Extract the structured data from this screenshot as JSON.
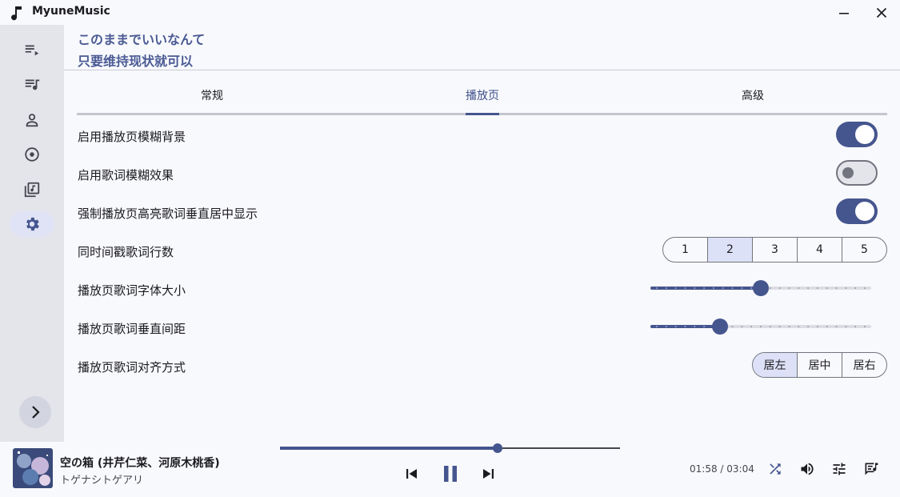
{
  "window": {
    "title": "MyuneMusic",
    "minimize_icon": "minimize-icon",
    "close_icon": "close-icon"
  },
  "sidebar": {
    "items": [
      {
        "icon": "playlist-play-icon",
        "active": false
      },
      {
        "icon": "queue-music-icon",
        "active": false
      },
      {
        "icon": "person-icon",
        "active": false
      },
      {
        "icon": "album-icon",
        "active": false
      },
      {
        "icon": "library-music-icon",
        "active": false
      },
      {
        "icon": "settings-gear-icon",
        "active": true
      }
    ],
    "expand_icon": "chevron-right-icon"
  },
  "lyrics": {
    "line1": "このままでいいなんて",
    "line2": "只要维持现状就可以"
  },
  "tabs": [
    {
      "label": "常规",
      "active": false
    },
    {
      "label": "播放页",
      "active": true
    },
    {
      "label": "高级",
      "active": false
    }
  ],
  "settings": {
    "blur_background": {
      "label": "启用播放页模糊背景",
      "enabled": true
    },
    "lyric_blur": {
      "label": "启用歌词模糊效果",
      "enabled": false
    },
    "force_center": {
      "label": "强制播放页高亮歌词垂直居中显示",
      "enabled": true
    },
    "lines_per_timestamp": {
      "label": "同时间戳歌词行数",
      "options": [
        "1",
        "2",
        "3",
        "4",
        "5"
      ],
      "selected": "2"
    },
    "font_size": {
      "label": "播放页歌词字体大小",
      "fraction": 0.5
    },
    "line_spacing": {
      "label": "播放页歌词垂直间距",
      "fraction": 0.3
    },
    "alignment": {
      "label": "播放页歌词对齐方式",
      "options": [
        "居左",
        "居中",
        "居右"
      ],
      "selected": "居左"
    }
  },
  "player": {
    "title": "空の箱 (井芹仁菜、河原木桃香)",
    "artist": "トゲナシトゲアリ",
    "current_time": "01:58",
    "total_time": "03:04",
    "time_display": "01:58 / 03:04",
    "progress_fraction": 0.641,
    "accent_color": "#45558e",
    "controls": [
      "skip-previous-icon",
      "pause-icon",
      "skip-next-icon",
      "shuffle-icon",
      "volume-icon",
      "equalizer-icon",
      "lyrics-icon"
    ]
  }
}
